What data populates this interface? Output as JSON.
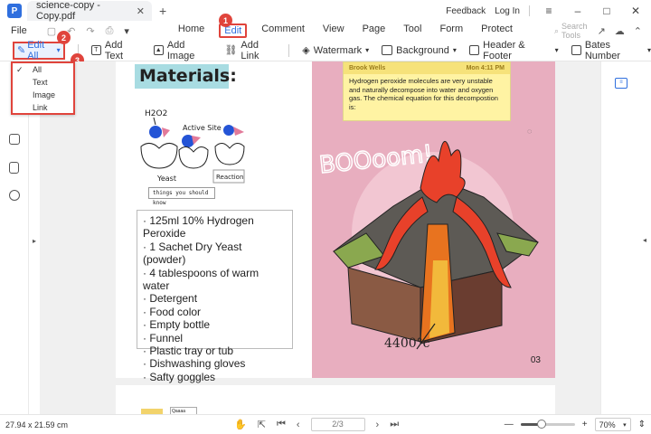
{
  "titlebar": {
    "tab_title": "science-copy - Copy.pdf",
    "feedback": "Feedback",
    "login": "Log In"
  },
  "menubar": {
    "file": "File",
    "items": [
      "Home",
      "Edit",
      "Comment",
      "View",
      "Page",
      "Tool",
      "Form",
      "Protect"
    ],
    "active_item": "Edit",
    "search_placeholder": "Search Tools"
  },
  "toolbar": {
    "edit_all": "Edit All",
    "add_text": "Add Text",
    "add_image": "Add Image",
    "add_link": "Add Link",
    "watermark": "Watermark",
    "background": "Background",
    "header_footer": "Header & Footer",
    "bates_number": "Bates Number"
  },
  "dropdown": {
    "options": [
      "All",
      "Text",
      "Image",
      "Link"
    ],
    "selected": "All"
  },
  "badges": [
    "1",
    "2",
    "3"
  ],
  "document": {
    "materials_title": "Materials:",
    "diagram_labels": {
      "h2o2": "H2O2",
      "active_site": "Active Site",
      "yeast": "Yeast",
      "reaction": "Reaction"
    },
    "caption": "things you should know",
    "materials": [
      "125ml 10% Hydrogen Peroxide",
      "1 Sachet Dry Yeast (powder)",
      "4 tablespoons of warm water",
      "Detergent",
      "Food color",
      "Empty bottle",
      "Funnel",
      "Plastic tray or tub",
      "Dishwashing gloves",
      "Safty goggles"
    ],
    "note": {
      "author": "Brook Wells",
      "time": "Mon 4:11 PM",
      "body": "Hydrogen peroxide molecules are very unstable and naturally decompose into water and oxygen gas. The chemical equation for this decompostion is:"
    },
    "boom_text": "BOOoom!",
    "temperature": "4400°c",
    "page_number": "03",
    "next_page_label": "Qaaaa"
  },
  "statusbar": {
    "dimensions": "27.94 x 21.59 cm",
    "page_field": "2/3",
    "zoom_level": "70%",
    "zoom_fraction": 0.38
  },
  "colors": {
    "accent": "#2f6fde",
    "highlight_red": "#e0443c",
    "pink_bg": "#e8aebf",
    "note_yellow": "#fff3a3"
  }
}
